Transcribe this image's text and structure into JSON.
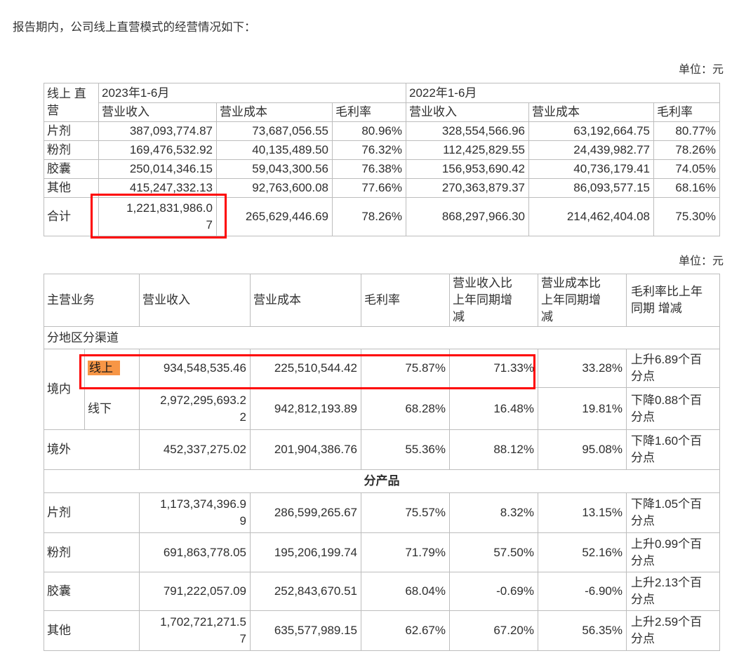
{
  "page": {
    "intro": "报告期内，公司线上直营模式的经营情况如下：",
    "unit_label": "单位：元"
  },
  "annotations": {
    "red_box_color": "#fe0000",
    "highlight_color": "#f79646",
    "highlighted_text": "线上",
    "red_boxed_values": [
      "1,221,831,986.07",
      "线上 934,548,535.46 225,510,544.42 75.87% 71.33%"
    ]
  },
  "table_online_direct": {
    "corner": "线上 直营",
    "periods": [
      "2023年1-6月",
      "2022年1-6月"
    ],
    "metrics": [
      "营业收入",
      "营业成本",
      "毛利率"
    ],
    "rows": [
      {
        "label": "片剂",
        "cells": [
          "387,093,774.87",
          "73,687,056.55",
          "80.96%",
          "328,554,566.96",
          "63,192,664.75",
          "80.77%"
        ]
      },
      {
        "label": "粉剂",
        "cells": [
          "169,476,532.92",
          "40,135,489.50",
          "76.32%",
          "112,425,829.55",
          "24,439,982.77",
          "78.26%"
        ]
      },
      {
        "label": "胶囊",
        "cells": [
          "250,014,346.15",
          "59,043,300.56",
          "76.38%",
          "156,953,690.42",
          "40,736,179.41",
          "74.05%"
        ]
      },
      {
        "label": "其他",
        "cells": [
          "415,247,332.13",
          "92,763,600.08",
          "77.66%",
          "270,363,879.37",
          "86,093,577.15",
          "68.16%"
        ]
      },
      {
        "label": "合计",
        "cells": [
          "1,221,831,986.07",
          "265,629,446.69",
          "78.26%",
          "868,297,966.30",
          "214,462,404.08",
          "75.30%"
        ]
      }
    ]
  },
  "table_main_business": {
    "headers": [
      "主营业务",
      "营业收入",
      "营业成本",
      "毛利率",
      "营业收入比上年同期增减",
      "营业成本比上年同期增减",
      "毛利率比上年同期 增减"
    ],
    "section_region_channel": "分地区分渠道",
    "section_product": "分产品",
    "domestic_label": "境内",
    "region_rows": [
      {
        "label": "线上",
        "cells": [
          "934,548,535.46",
          "225,510,544.42",
          "75.87%",
          "71.33%",
          "33.28%",
          "上升6.89个百分点"
        ]
      },
      {
        "label": "线下",
        "cells": [
          "2,972,295,693.22",
          "942,812,193.89",
          "68.28%",
          "16.48%",
          "19.81%",
          "下降0.88个百分点"
        ]
      },
      {
        "label": "境外",
        "cells": [
          "452,337,275.02",
          "201,904,386.76",
          "55.36%",
          "88.12%",
          "95.08%",
          "下降1.60个百分点"
        ]
      }
    ],
    "product_rows": [
      {
        "label": "片剂",
        "cells": [
          "1,173,374,396.99",
          "286,599,265.67",
          "75.57%",
          "8.32%",
          "13.15%",
          "下降1.05个百分点"
        ]
      },
      {
        "label": "粉剂",
        "cells": [
          "691,863,778.05",
          "195,206,199.74",
          "71.79%",
          "57.50%",
          "52.16%",
          "上升0.99个百分点"
        ]
      },
      {
        "label": "胶囊",
        "cells": [
          "791,222,057.09",
          "252,843,670.51",
          "68.04%",
          "-0.69%",
          "-6.90%",
          "上升2.13个百分点"
        ]
      },
      {
        "label": "其他",
        "cells": [
          "1,702,721,271.57",
          "635,577,989.15",
          "62.67%",
          "67.20%",
          "56.35%",
          "上升2.59个百分点"
        ]
      }
    ]
  }
}
